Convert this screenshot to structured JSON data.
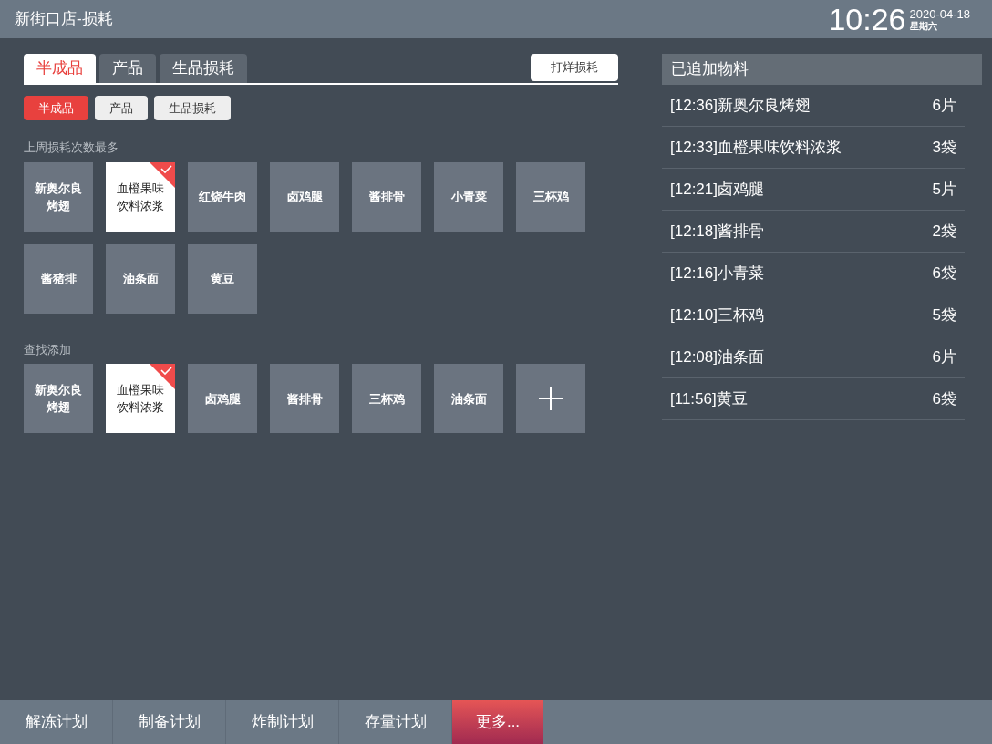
{
  "header": {
    "title": "新街口店-损耗",
    "time": "10:26",
    "date": "2020-04-18",
    "weekday": "星期六"
  },
  "tabs": [
    {
      "label": "半成品",
      "selected": true
    },
    {
      "label": "产品",
      "selected": false
    },
    {
      "label": "生品损耗",
      "selected": false
    }
  ],
  "sample_button": "打烊损耗",
  "filters": [
    {
      "label": "半成品",
      "selected": true
    },
    {
      "label": "产品",
      "selected": false
    },
    {
      "label": "生品损耗",
      "selected": false
    }
  ],
  "sections": [
    {
      "title": "上周损耗次数最多",
      "tiles": [
        {
          "kind": "item",
          "label": "新奥尔良烤翅",
          "selected": false
        },
        {
          "kind": "item",
          "label": "血橙果味饮料浓浆",
          "selected": true
        },
        {
          "kind": "item",
          "label": "红烧牛肉",
          "selected": false
        },
        {
          "kind": "item",
          "label": "卤鸡腿",
          "selected": false
        },
        {
          "kind": "item",
          "label": "酱排骨",
          "selected": false
        },
        {
          "kind": "item",
          "label": "小青菜",
          "selected": false
        },
        {
          "kind": "item",
          "label": "三杯鸡",
          "selected": false
        },
        {
          "kind": "item",
          "label": "酱猪排",
          "selected": false
        },
        {
          "kind": "item",
          "label": "油条面",
          "selected": false
        },
        {
          "kind": "item",
          "label": "黄豆",
          "selected": false
        }
      ]
    },
    {
      "title": "查找添加",
      "tiles": [
        {
          "kind": "item",
          "label": "新奥尔良烤翅",
          "selected": false
        },
        {
          "kind": "item",
          "label": "血橙果味饮料浓浆",
          "selected": true
        },
        {
          "kind": "item",
          "label": "卤鸡腿",
          "selected": false
        },
        {
          "kind": "item",
          "label": "酱排骨",
          "selected": false
        },
        {
          "kind": "item",
          "label": "三杯鸡",
          "selected": false
        },
        {
          "kind": "item",
          "label": "油条面",
          "selected": false
        },
        {
          "kind": "add"
        }
      ]
    }
  ],
  "added_panel": {
    "title": "已追加物料",
    "rows": [
      {
        "name": "[12:36]新奥尔良烤翅",
        "quantity": "6片"
      },
      {
        "name": "[12:33]血橙果味饮料浓浆",
        "quantity": "3袋"
      },
      {
        "name": "[12:21]卤鸡腿",
        "quantity": "5片"
      },
      {
        "name": "[12:18]酱排骨",
        "quantity": "2袋"
      },
      {
        "name": "[12:16]小青菜",
        "quantity": "6袋"
      },
      {
        "name": "[12:10]三杯鸡",
        "quantity": "5袋"
      },
      {
        "name": "[12:08]油条面",
        "quantity": "6片"
      },
      {
        "name": "[11:56]黄豆",
        "quantity": "6袋"
      }
    ]
  },
  "bottom_nav": [
    {
      "label": "解冻计划",
      "selected": false
    },
    {
      "label": "制备计划",
      "selected": false
    },
    {
      "label": "炸制计划",
      "selected": false
    },
    {
      "label": "存量计划",
      "selected": false
    },
    {
      "label": "更多...",
      "selected": true
    }
  ]
}
